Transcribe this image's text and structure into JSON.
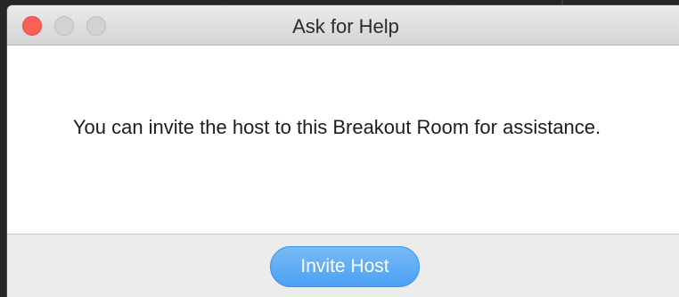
{
  "window": {
    "title": "Ask for Help",
    "controls": [
      "close-icon",
      "minimize-icon",
      "zoom-icon"
    ]
  },
  "dialog": {
    "message": "You can invite the host to this Breakout Room for assistance."
  },
  "actions": {
    "invite_host_label": "Invite Host"
  },
  "colors": {
    "close": "#fc5f57",
    "inactive_control": "#d2d2d2",
    "button": "#4aa1f3"
  }
}
